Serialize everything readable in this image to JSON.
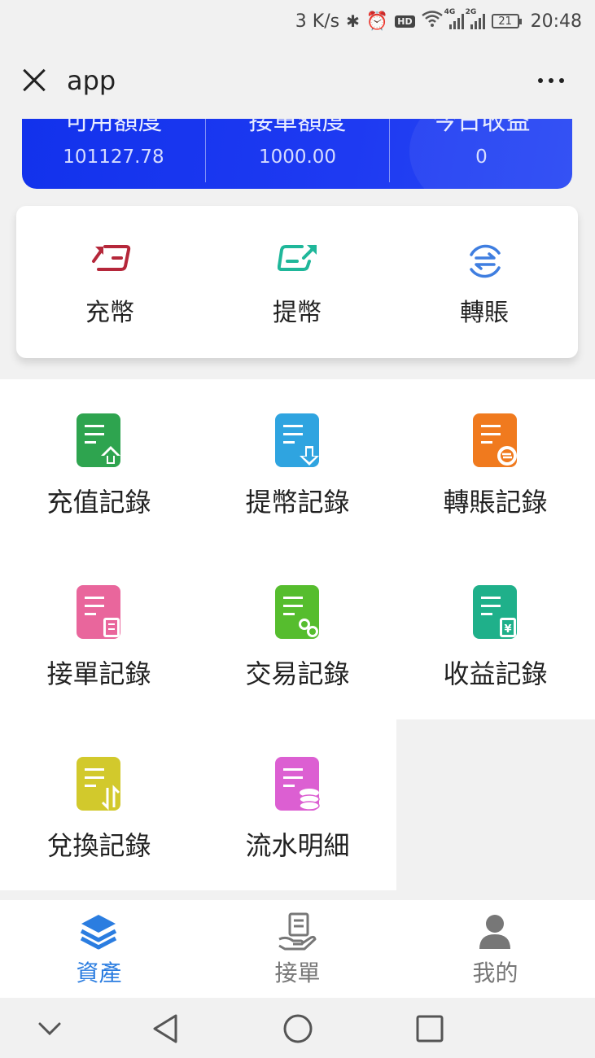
{
  "status_bar": {
    "speed": "3 K/s",
    "hd": "HD",
    "net1": "4G",
    "net2": "2G",
    "battery": "21",
    "time": "20:48"
  },
  "app_bar": {
    "title": "app"
  },
  "summary": {
    "stats": [
      {
        "label": "可用額度",
        "value": "101127.78"
      },
      {
        "label": "接單額度",
        "value": "1000.00"
      },
      {
        "label": "今日收益",
        "value": "0"
      }
    ]
  },
  "actions": [
    {
      "label": "充幣",
      "icon": "deposit-icon",
      "color": "#b5273a"
    },
    {
      "label": "提幣",
      "icon": "withdraw-icon",
      "color": "#1fb79a"
    },
    {
      "label": "轉賬",
      "icon": "transfer-icon",
      "color": "#3f7ee0"
    }
  ],
  "records": [
    {
      "label": "充值記錄",
      "icon": "recharge-record-icon",
      "color": "#2ea44f"
    },
    {
      "label": "提幣記錄",
      "icon": "withdraw-record-icon",
      "color": "#2fa4e0"
    },
    {
      "label": "轉賬記錄",
      "icon": "transfer-record-icon",
      "color": "#f07a1e"
    },
    {
      "label": "接單記錄",
      "icon": "order-record-icon",
      "color": "#e9669c"
    },
    {
      "label": "交易記錄",
      "icon": "trade-record-icon",
      "color": "#56bd2e"
    },
    {
      "label": "收益記錄",
      "icon": "income-record-icon",
      "color": "#1fb08a"
    },
    {
      "label": "兌換記錄",
      "icon": "exchange-record-icon",
      "color": "#d2c92c"
    },
    {
      "label": "流水明細",
      "icon": "ledger-detail-icon",
      "color": "#dc5fd2"
    }
  ],
  "bottom_nav": {
    "items": [
      {
        "label": "資產",
        "icon": "layers-icon",
        "active": true
      },
      {
        "label": "接單",
        "icon": "hand-receipt-icon",
        "active": false
      },
      {
        "label": "我的",
        "icon": "user-icon",
        "active": false
      }
    ],
    "active_color": "#2b7de0",
    "inactive_color": "#777777"
  }
}
